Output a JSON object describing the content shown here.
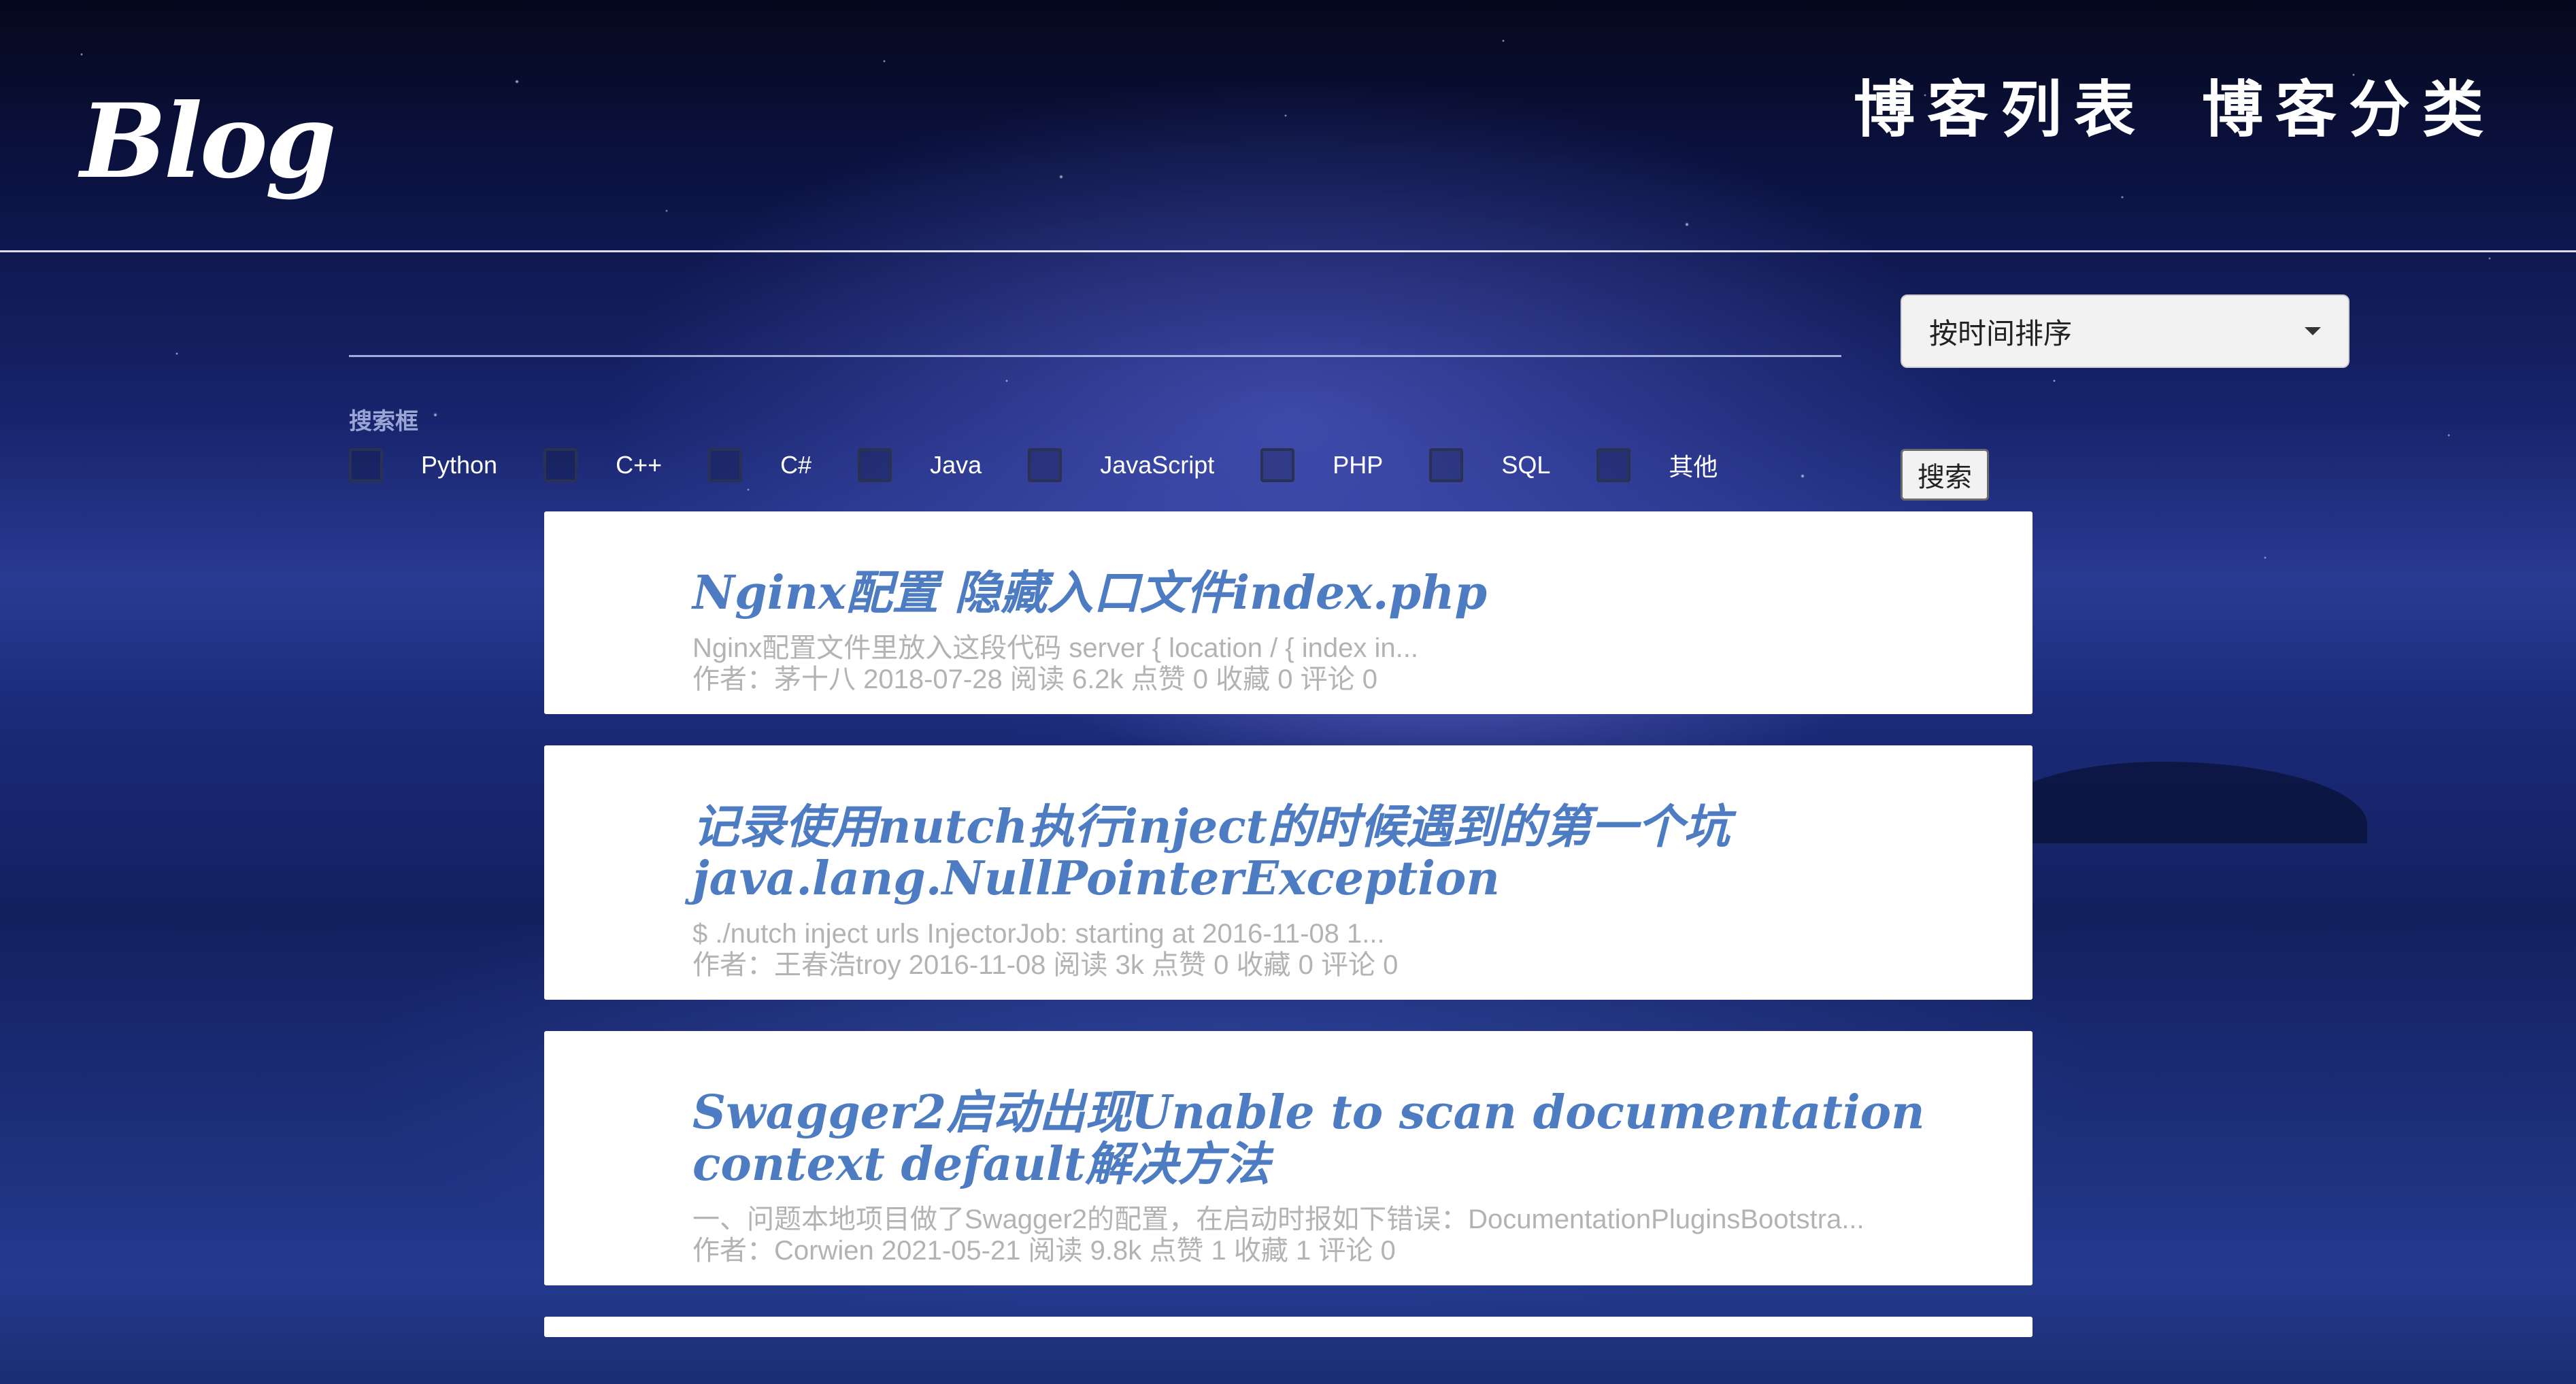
{
  "header": {
    "logo": "Blog",
    "nav": [
      "博客列表",
      "博客分类"
    ]
  },
  "search": {
    "placeholder": "",
    "label": "搜索框",
    "button_label": "搜索",
    "sort_selected": "按时间排序"
  },
  "filters": [
    "Python",
    "C++",
    "C#",
    "Java",
    "JavaScript",
    "PHP",
    "SQL",
    "其他"
  ],
  "posts": [
    {
      "title": "Nginx配置 隐藏入口文件index.php",
      "excerpt": "Nginx配置文件里放入这段代码 server { location / { index in...",
      "meta": "作者：茅十八 2018-07-28 阅读 6.2k 点赞 0 收藏 0 评论 0"
    },
    {
      "title": "记录使用nutch执行inject的时候遇到的第一个坑java.lang.NullPointerException",
      "excerpt": "$ ./nutch inject urls InjectorJob: starting at 2016-11-08 1...",
      "meta": "作者：王春浩troy 2016-11-08 阅读 3k 点赞 0 收藏 0 评论 0"
    },
    {
      "title": "Swagger2启动出现Unable to scan documentation context default解决方法",
      "excerpt": "一、问题本地项目做了Swagger2的配置，在启动时报如下错误：DocumentationPluginsBootstra...",
      "meta": "作者：Corwien 2021-05-21 阅读 9.8k 点赞 1 收藏 1 评论 0"
    }
  ]
}
